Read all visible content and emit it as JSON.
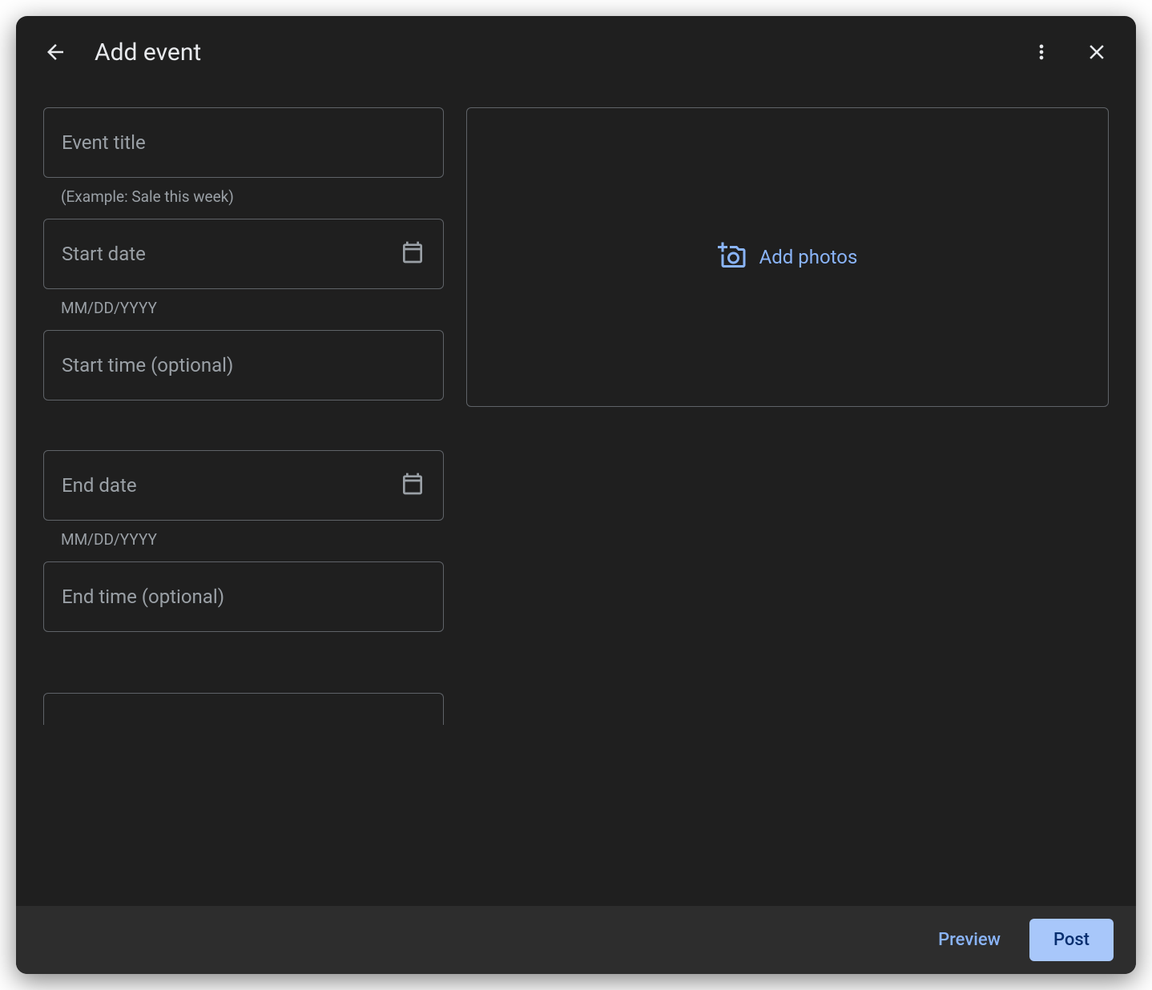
{
  "header": {
    "title": "Add event"
  },
  "fields": {
    "event_title": {
      "placeholder": "Event title",
      "value": "",
      "hint": "(Example: Sale this week)"
    },
    "start_date": {
      "label": "Start date",
      "value": "",
      "hint": "MM/DD/YYYY"
    },
    "start_time": {
      "label": "Start time (optional)",
      "value": ""
    },
    "end_date": {
      "label": "End date",
      "value": "",
      "hint": "MM/DD/YYYY"
    },
    "end_time": {
      "label": "End time (optional)",
      "value": ""
    }
  },
  "photo": {
    "add_label": "Add photos"
  },
  "footer": {
    "preview_label": "Preview",
    "post_label": "Post"
  }
}
